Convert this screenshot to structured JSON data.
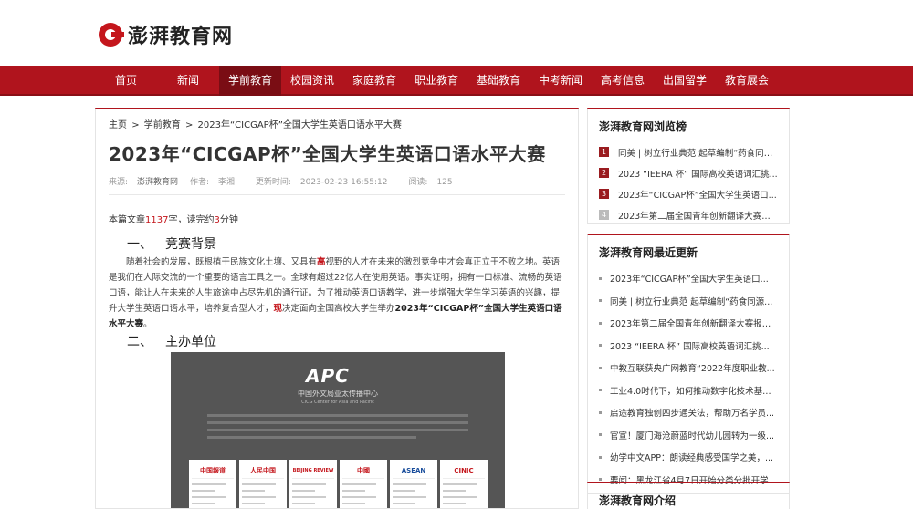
{
  "site": {
    "name": "澎湃教育网"
  },
  "nav": [
    "首页",
    "新闻",
    "学前教育",
    "校园资讯",
    "家庭教育",
    "职业教育",
    "基础教育",
    "中考新闻",
    "高考信息",
    "出国留学",
    "教育展会"
  ],
  "breadcrumb": [
    "主页",
    ">",
    "学前教育",
    ">",
    "2023年“CICGAP杯”全国大学生英语口语水平大赛"
  ],
  "article": {
    "title": "2023年“CICGAP杯”全国大学生英语口语水平大赛",
    "meta": {
      "source_label": "来源:",
      "source": "澎湃教育网",
      "author_label": "作者:",
      "author": "李湘",
      "time_label": "更新时间:",
      "time": "2023-02-23 16:55:12",
      "reads_label": "阅读:",
      "reads": "125"
    },
    "stats": {
      "prefix": "本篇文章",
      "chars": "1137",
      "mid": "字，读完约",
      "minutes": "3",
      "suffix": "分钟"
    },
    "section1": {
      "num": "一、",
      "title": "竞赛背景"
    },
    "para1": {
      "a": "随着社会的发展，既根植于民族文化土壤、又具有",
      "hl1": "高",
      "b": "视野的人才在未来的激烈竞争中才会真正立于不败之地。英语是我们在人际交流的一个重要的语言工具之一。全球有超过22亿人在使用英语。事实证明，拥有一口标准、流畅的英语口语，能让人在未来的人生旅途中占尽先机的通行证。为了推动英语口语教学，进一步增强大学生学习英语的兴趣，提升大学生英语口语水平，培养复合型人才，",
      "hl2": "现",
      "c": "决定面向全国高校大学生举办",
      "bold": "2023年“CICGAP杯”全国大学生英语口语水平大赛",
      "d": "。"
    },
    "section2": {
      "num": "二、",
      "title": "主办单位"
    },
    "poster": {
      "logo": "APC",
      "subtitle": "中国外文局亚太传播中心",
      "subtitle_en": "CICG Center for Asia and Pacific",
      "cards": [
        "中国報道",
        "人民中国",
        "BEIJING REVIEW",
        "中國",
        "ASEAN",
        "CINIC"
      ]
    }
  },
  "sidebar": {
    "ranking": {
      "title": "澎湃教育网浏览榜",
      "items": [
        "同美 | 树立行业典范 起草编制“药食同源...",
        "2023 “IEERA 杯” 国际高校英语词汇挑...",
        "2023年“CICGAP杯”全国大学生英语口...",
        "2023年第二届全国青年创新翻译大赛报名..."
      ]
    },
    "latest": {
      "title": "澎湃教育网最近更新",
      "items": [
        "2023年“CICGAP杯”全国大学生英语口...",
        "同美 | 树立行业典范 起草编制“药食同源...",
        "2023年第二届全国青年创新翻译大赛报名...",
        "2023 “IEERA 杯” 国际高校英语词汇挑...",
        "中教互联获央广网教育“2022年度职业教...",
        "工业4.0时代下，如何推动数字化技术基础...",
        "启途教育独创四步通关法，帮助万名学员...",
        "官宣！厦门海沧蔚蓝时代幼儿园转为一级...",
        "幼学中文APP：朗读经典感受国学之美，...",
        "要闻：黑龙江省4月7日开始分类分批开学..."
      ]
    },
    "intro": {
      "title": "澎湃教育网介绍"
    }
  }
}
